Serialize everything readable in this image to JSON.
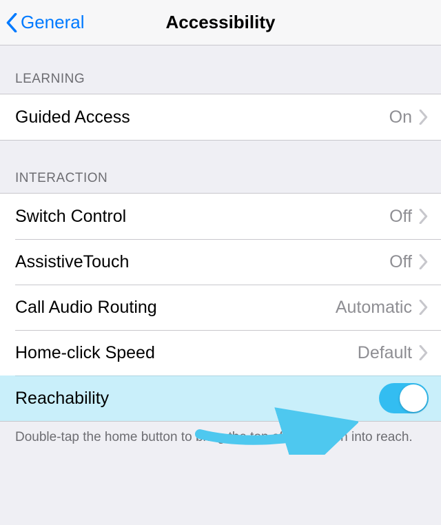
{
  "nav": {
    "back_label": "General",
    "title": "Accessibility"
  },
  "sections": {
    "learning": {
      "header": "LEARNING",
      "items": [
        {
          "label": "Guided Access",
          "value": "On"
        }
      ]
    },
    "interaction": {
      "header": "INTERACTION",
      "items": [
        {
          "label": "Switch Control",
          "value": "Off"
        },
        {
          "label": "AssistiveTouch",
          "value": "Off"
        },
        {
          "label": "Call Audio Routing",
          "value": "Automatic"
        },
        {
          "label": "Home-click Speed",
          "value": "Default"
        },
        {
          "label": "Reachability",
          "toggle": true
        }
      ]
    }
  },
  "footer": "Double-tap the home button to bring the top of the screen into reach.",
  "colors": {
    "link": "#007aff",
    "toggle_on": "#33bdf1",
    "highlight": "#c9effa",
    "arrow": "#4ec8ef"
  }
}
